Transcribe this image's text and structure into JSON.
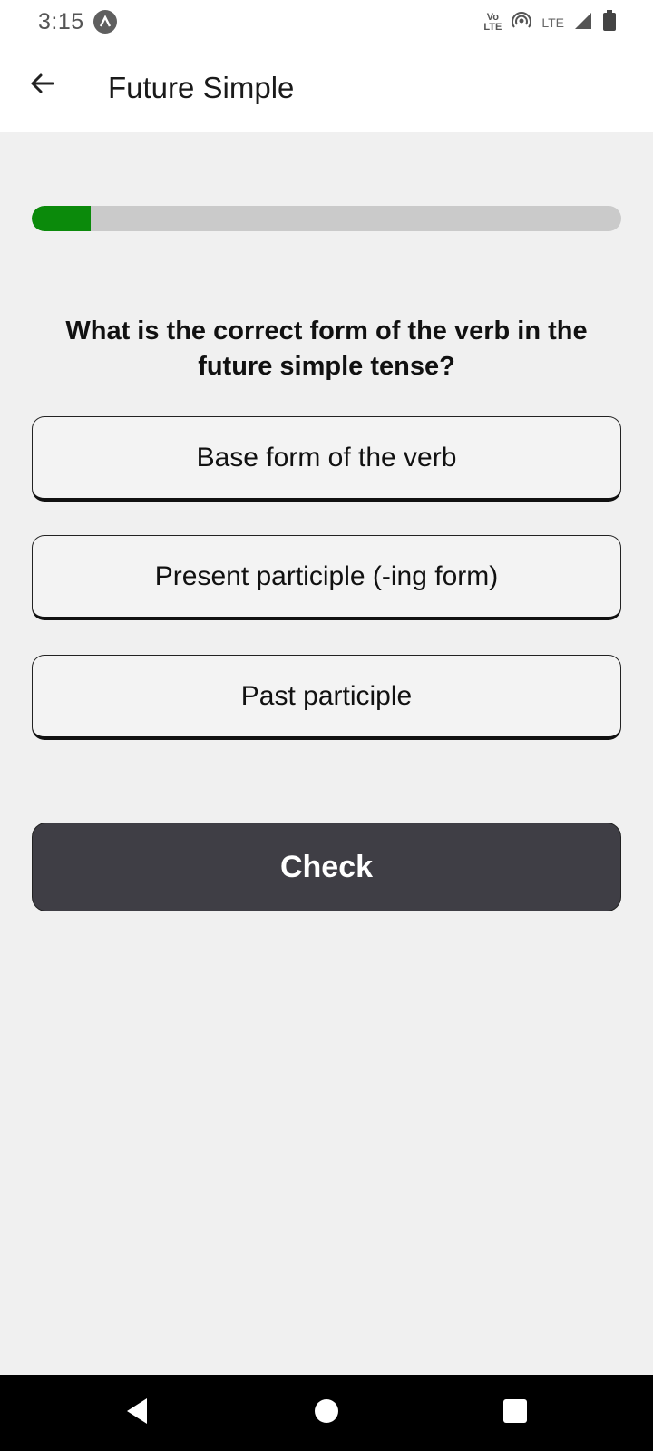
{
  "status_bar": {
    "time": "3:15",
    "volte_top": "Vo",
    "volte_bottom": "LTE",
    "network": "LTE",
    "icons": [
      "app-notification-icon",
      "volte-icon",
      "hotspot-icon",
      "lte-icon",
      "signal-icon",
      "battery-icon"
    ]
  },
  "app_bar": {
    "title": "Future Simple",
    "back_icon": "back-arrow-icon"
  },
  "quiz": {
    "progress": 0.1,
    "progress_color": "#0b8a0b",
    "question": "What is the correct form of the verb in the future simple tense?",
    "options": [
      {
        "label": "Base form of the verb"
      },
      {
        "label": "Present participle (-ing form)"
      },
      {
        "label": "Past participle"
      }
    ],
    "check_label": "Check",
    "check_color": "#3f3e45"
  },
  "nav_bar": {
    "icons": [
      "nav-back-icon",
      "nav-home-icon",
      "nav-recents-icon"
    ]
  }
}
